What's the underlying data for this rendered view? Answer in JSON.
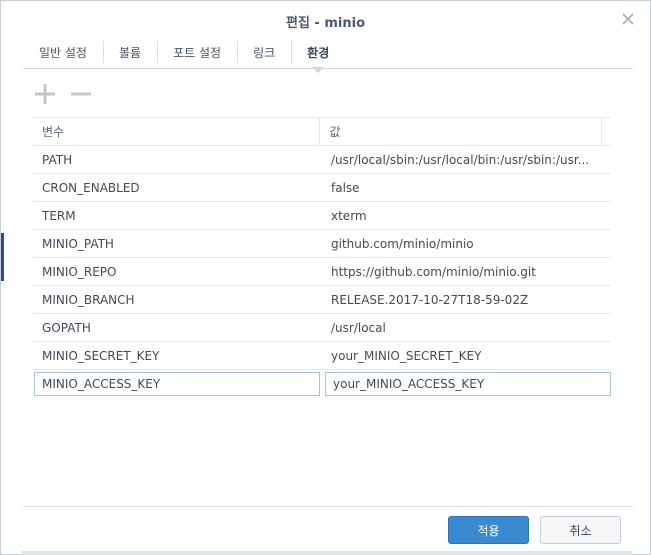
{
  "window": {
    "title": "편집 - minio",
    "close_icon": "close-icon"
  },
  "tabs": [
    {
      "label": "일반 설정",
      "active": false
    },
    {
      "label": "볼륨",
      "active": false
    },
    {
      "label": "포트 설정",
      "active": false
    },
    {
      "label": "링크",
      "active": false
    },
    {
      "label": "환경",
      "active": true
    }
  ],
  "toolbar": {
    "add_icon": "plus-icon",
    "remove_icon": "minus-icon"
  },
  "table": {
    "headers": {
      "variable": "변수",
      "value": "값"
    },
    "rows": [
      {
        "variable": "PATH",
        "value": "/usr/local/sbin:/usr/local/bin:/usr/sbin:/usr..."
      },
      {
        "variable": "CRON_ENABLED",
        "value": "false"
      },
      {
        "variable": "TERM",
        "value": "xterm"
      },
      {
        "variable": "MINIO_PATH",
        "value": "github.com/minio/minio"
      },
      {
        "variable": "MINIO_REPO",
        "value": "https://github.com/minio/minio.git"
      },
      {
        "variable": "MINIO_BRANCH",
        "value": "RELEASE.2017-10-27T18-59-02Z"
      },
      {
        "variable": "GOPATH",
        "value": "/usr/local"
      },
      {
        "variable": "MINIO_SECRET_KEY",
        "value": "your_MINIO_SECRET_KEY"
      }
    ],
    "editing_row": {
      "variable": "MINIO_ACCESS_KEY",
      "value": "your_MINIO_ACCESS_KEY"
    }
  },
  "footer": {
    "apply_label": "적용",
    "cancel_label": "취소"
  },
  "colors": {
    "primary": "#3a8ad1",
    "accent_bar": "#2b4f80"
  }
}
